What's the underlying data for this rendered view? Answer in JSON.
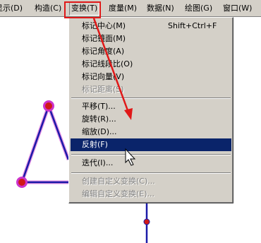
{
  "menubar": {
    "items": [
      {
        "label": "显示(D)"
      },
      {
        "label": "构造(C)"
      },
      {
        "label": "变换(T)"
      },
      {
        "label": "度量(M)"
      },
      {
        "label": "数据(N)"
      },
      {
        "label": "绘图(G)"
      },
      {
        "label": "窗口(W)"
      }
    ]
  },
  "menu": {
    "items": [
      {
        "label": "标记中心(M)",
        "shortcut": "Shift+Ctrl+F"
      },
      {
        "label": "标记镜面(M)"
      },
      {
        "label": "标记角度(A)"
      },
      {
        "label": "标记线段比(O)"
      },
      {
        "label": "标记向量(V)"
      },
      {
        "label": "标记距离(S)"
      },
      {
        "label": "平移(T)..."
      },
      {
        "label": "旋转(R)..."
      },
      {
        "label": "缩放(D)..."
      },
      {
        "label": "反射(F)"
      },
      {
        "label": "迭代(I)..."
      },
      {
        "label": "创建自定义变换(C)..."
      },
      {
        "label": "编辑自定义变换(E)..."
      }
    ]
  },
  "colors": {
    "highlight": "#0a246a",
    "annotation": "#e01818",
    "shape_stroke": "#1a1aa8",
    "shape_glow": "#cc33cc",
    "point_fill": "#d01818"
  }
}
